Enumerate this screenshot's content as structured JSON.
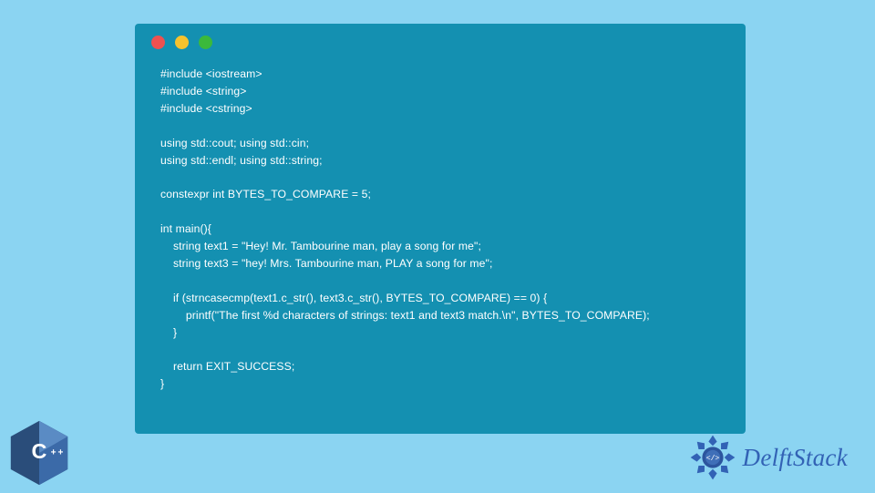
{
  "code": {
    "line1": "#include <iostream>",
    "line2": "#include <string>",
    "line3": "#include <cstring>",
    "blank1": "",
    "line4": "using std::cout; using std::cin;",
    "line5": "using std::endl; using std::string;",
    "blank2": "",
    "line6": "constexpr int BYTES_TO_COMPARE = 5;",
    "blank3": "",
    "line7": "int main(){",
    "line8": "    string text1 = \"Hey! Mr. Tambourine man, play a song for me\";",
    "line9": "    string text3 = \"hey! Mrs. Tambourine man, PLAY a song for me\";",
    "blank4": "",
    "line10": "    if (strncasecmp(text1.c_str(), text3.c_str(), BYTES_TO_COMPARE) == 0) {",
    "line11": "        printf(\"The first %d characters of strings: text1 and text3 match.\\n\", BYTES_TO_COMPARE);",
    "line12": "    }",
    "blank5": "",
    "line13": "    return EXIT_SUCCESS;",
    "line14": "}"
  },
  "brand": {
    "text": "DelftStack"
  },
  "cpp": {
    "label": "C++"
  },
  "dots": {
    "red": "close",
    "yellow": "minimize",
    "green": "maximize"
  }
}
